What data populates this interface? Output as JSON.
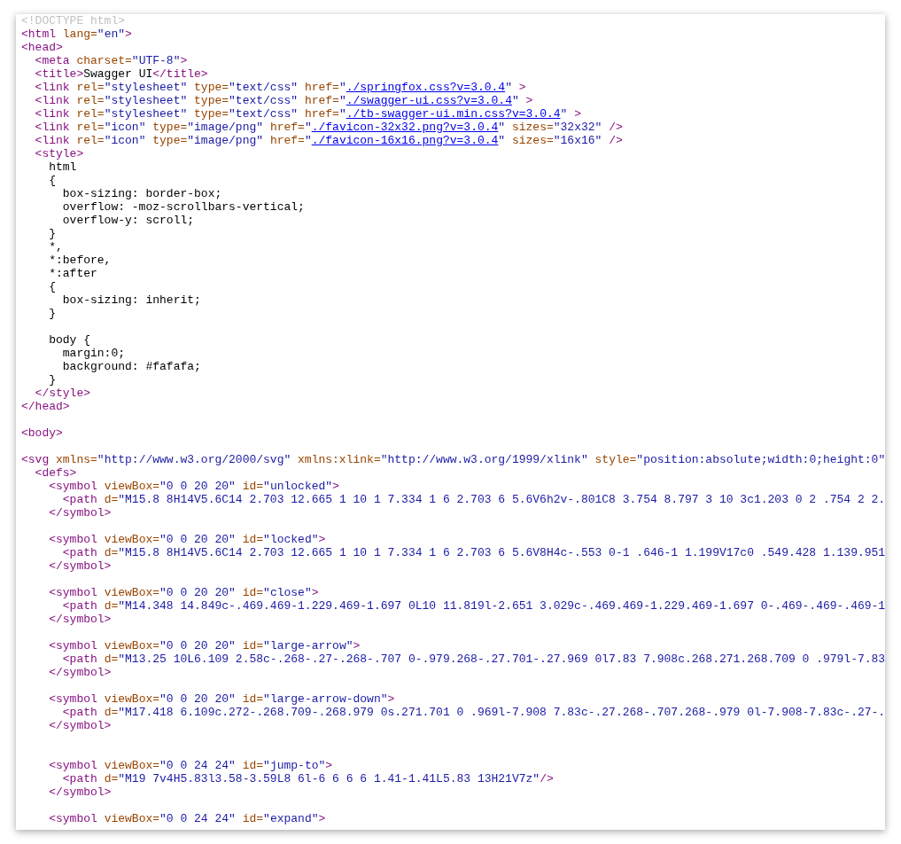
{
  "source_lines": [
    {
      "kind": "code",
      "tokens": [
        {
          "kind": "doctype",
          "text": "<!DOCTYPE html>"
        }
      ]
    },
    {
      "kind": "code",
      "tokens": [
        {
          "kind": "tag",
          "text": "<html"
        },
        {
          "kind": "attr",
          "text": " lang="
        },
        {
          "kind": "value",
          "text": "\"en\""
        },
        {
          "kind": "tag",
          "text": ">"
        }
      ]
    },
    {
      "kind": "code",
      "tokens": [
        {
          "kind": "tag",
          "text": "<head>"
        }
      ]
    },
    {
      "kind": "code",
      "tokens": [
        {
          "kind": "tag",
          "text": "  <meta"
        },
        {
          "kind": "attr",
          "text": " charset="
        },
        {
          "kind": "value",
          "text": "\"UTF-8\""
        },
        {
          "kind": "tag",
          "text": ">"
        }
      ]
    },
    {
      "kind": "code",
      "tokens": [
        {
          "kind": "tag",
          "text": "  <title>"
        },
        {
          "kind": "text",
          "text": "Swagger UI"
        },
        {
          "kind": "tag",
          "text": "</title>"
        }
      ]
    },
    {
      "kind": "code",
      "tokens": [
        {
          "kind": "tag",
          "text": "  <link"
        },
        {
          "kind": "attr",
          "text": " rel="
        },
        {
          "kind": "value",
          "text": "\"stylesheet\""
        },
        {
          "kind": "attr",
          "text": " type="
        },
        {
          "kind": "value",
          "text": "\"text/css\""
        },
        {
          "kind": "attr",
          "text": " href="
        },
        {
          "kind": "value",
          "text": "\""
        },
        {
          "kind": "link",
          "text": "./springfox.css?v=3.0.4"
        },
        {
          "kind": "value",
          "text": "\""
        },
        {
          "kind": "tag",
          "text": " >"
        }
      ]
    },
    {
      "kind": "code",
      "tokens": [
        {
          "kind": "tag",
          "text": "  <link"
        },
        {
          "kind": "attr",
          "text": " rel="
        },
        {
          "kind": "value",
          "text": "\"stylesheet\""
        },
        {
          "kind": "attr",
          "text": " type="
        },
        {
          "kind": "value",
          "text": "\"text/css\""
        },
        {
          "kind": "attr",
          "text": " href="
        },
        {
          "kind": "value",
          "text": "\""
        },
        {
          "kind": "link",
          "text": "./swagger-ui.css?v=3.0.4"
        },
        {
          "kind": "value",
          "text": "\""
        },
        {
          "kind": "tag",
          "text": " >"
        }
      ]
    },
    {
      "kind": "code",
      "tokens": [
        {
          "kind": "tag",
          "text": "  <link"
        },
        {
          "kind": "attr",
          "text": " rel="
        },
        {
          "kind": "value",
          "text": "\"stylesheet\""
        },
        {
          "kind": "attr",
          "text": " type="
        },
        {
          "kind": "value",
          "text": "\"text/css\""
        },
        {
          "kind": "attr",
          "text": " href="
        },
        {
          "kind": "value",
          "text": "\""
        },
        {
          "kind": "link",
          "text": "./tb-swagger-ui.min.css?v=3.0.4"
        },
        {
          "kind": "value",
          "text": "\""
        },
        {
          "kind": "tag",
          "text": " >"
        }
      ]
    },
    {
      "kind": "code",
      "tokens": [
        {
          "kind": "tag",
          "text": "  <link"
        },
        {
          "kind": "attr",
          "text": " rel="
        },
        {
          "kind": "value",
          "text": "\"icon\""
        },
        {
          "kind": "attr",
          "text": " type="
        },
        {
          "kind": "value",
          "text": "\"image/png\""
        },
        {
          "kind": "attr",
          "text": " href="
        },
        {
          "kind": "value",
          "text": "\""
        },
        {
          "kind": "link",
          "text": "./favicon-32x32.png?v=3.0.4"
        },
        {
          "kind": "value",
          "text": "\""
        },
        {
          "kind": "attr",
          "text": " sizes="
        },
        {
          "kind": "value",
          "text": "\"32x32\""
        },
        {
          "kind": "tag",
          "text": " />"
        }
      ]
    },
    {
      "kind": "code",
      "tokens": [
        {
          "kind": "tag",
          "text": "  <link"
        },
        {
          "kind": "attr",
          "text": " rel="
        },
        {
          "kind": "value",
          "text": "\"icon\""
        },
        {
          "kind": "attr",
          "text": " type="
        },
        {
          "kind": "value",
          "text": "\"image/png\""
        },
        {
          "kind": "attr",
          "text": " href="
        },
        {
          "kind": "value",
          "text": "\""
        },
        {
          "kind": "link",
          "text": "./favicon-16x16.png?v=3.0.4"
        },
        {
          "kind": "value",
          "text": "\""
        },
        {
          "kind": "attr",
          "text": " sizes="
        },
        {
          "kind": "value",
          "text": "\"16x16\""
        },
        {
          "kind": "tag",
          "text": " />"
        }
      ]
    },
    {
      "kind": "code",
      "tokens": [
        {
          "kind": "tag",
          "text": "  <style>"
        }
      ]
    },
    {
      "kind": "code",
      "tokens": [
        {
          "kind": "text",
          "text": "    html"
        }
      ]
    },
    {
      "kind": "code",
      "tokens": [
        {
          "kind": "text",
          "text": "    {"
        }
      ]
    },
    {
      "kind": "code",
      "tokens": [
        {
          "kind": "text",
          "text": "      box-sizing: border-box;"
        }
      ]
    },
    {
      "kind": "code",
      "tokens": [
        {
          "kind": "text",
          "text": "      overflow: -moz-scrollbars-vertical;"
        }
      ]
    },
    {
      "kind": "code",
      "tokens": [
        {
          "kind": "text",
          "text": "      overflow-y: scroll;"
        }
      ]
    },
    {
      "kind": "code",
      "tokens": [
        {
          "kind": "text",
          "text": "    }"
        }
      ]
    },
    {
      "kind": "code",
      "tokens": [
        {
          "kind": "text",
          "text": "    *,"
        }
      ]
    },
    {
      "kind": "code",
      "tokens": [
        {
          "kind": "text",
          "text": "    *:before,"
        }
      ]
    },
    {
      "kind": "code",
      "tokens": [
        {
          "kind": "text",
          "text": "    *:after"
        }
      ]
    },
    {
      "kind": "code",
      "tokens": [
        {
          "kind": "text",
          "text": "    {"
        }
      ]
    },
    {
      "kind": "code",
      "tokens": [
        {
          "kind": "text",
          "text": "      box-sizing: inherit;"
        }
      ]
    },
    {
      "kind": "code",
      "tokens": [
        {
          "kind": "text",
          "text": "    }"
        }
      ]
    },
    {
      "kind": "blank"
    },
    {
      "kind": "code",
      "tokens": [
        {
          "kind": "text",
          "text": "    body {"
        }
      ]
    },
    {
      "kind": "code",
      "tokens": [
        {
          "kind": "text",
          "text": "      margin:0;"
        }
      ]
    },
    {
      "kind": "code",
      "tokens": [
        {
          "kind": "text",
          "text": "      background: #fafafa;"
        }
      ]
    },
    {
      "kind": "code",
      "tokens": [
        {
          "kind": "text",
          "text": "    }"
        }
      ]
    },
    {
      "kind": "code",
      "tokens": [
        {
          "kind": "tag",
          "text": "  </style>"
        }
      ]
    },
    {
      "kind": "code",
      "tokens": [
        {
          "kind": "tag",
          "text": "</head>"
        }
      ]
    },
    {
      "kind": "blank"
    },
    {
      "kind": "code",
      "tokens": [
        {
          "kind": "tag",
          "text": "<body>"
        }
      ]
    },
    {
      "kind": "blank"
    },
    {
      "kind": "code",
      "tokens": [
        {
          "kind": "tag",
          "text": "<svg"
        },
        {
          "kind": "attr",
          "text": " xmlns="
        },
        {
          "kind": "value",
          "text": "\"http://www.w3.org/2000/svg\""
        },
        {
          "kind": "attr",
          "text": " xmlns:xlink="
        },
        {
          "kind": "value",
          "text": "\"http://www.w3.org/1999/xlink\""
        },
        {
          "kind": "attr",
          "text": " style="
        },
        {
          "kind": "value",
          "text": "\"position:absolute;width:0;height:0\""
        }
      ]
    },
    {
      "kind": "code",
      "tokens": [
        {
          "kind": "tag",
          "text": "  <defs>"
        }
      ]
    },
    {
      "kind": "code",
      "tokens": [
        {
          "kind": "tag",
          "text": "    <symbol"
        },
        {
          "kind": "attr",
          "text": " viewBox="
        },
        {
          "kind": "value",
          "text": "\"0 0 20 20\""
        },
        {
          "kind": "attr",
          "text": " id="
        },
        {
          "kind": "value",
          "text": "\"unlocked\""
        },
        {
          "kind": "tag",
          "text": ">"
        }
      ]
    },
    {
      "kind": "code",
      "tokens": [
        {
          "kind": "tag",
          "text": "      <path"
        },
        {
          "kind": "attr",
          "text": " d="
        },
        {
          "kind": "value",
          "text": "\"M15.8 8H14V5.6C14 2.703 12.665 1 10 1 7.334 1 6 2.703 6 5.6V6h2v-.801C8 3.754 8.797 3 10 3c1.203 0 2 .754 2 2."
        }
      ]
    },
    {
      "kind": "code",
      "tokens": [
        {
          "kind": "tag",
          "text": "    </symbol>"
        }
      ]
    },
    {
      "kind": "blank"
    },
    {
      "kind": "code",
      "tokens": [
        {
          "kind": "tag",
          "text": "    <symbol"
        },
        {
          "kind": "attr",
          "text": " viewBox="
        },
        {
          "kind": "value",
          "text": "\"0 0 20 20\""
        },
        {
          "kind": "attr",
          "text": " id="
        },
        {
          "kind": "value",
          "text": "\"locked\""
        },
        {
          "kind": "tag",
          "text": ">"
        }
      ]
    },
    {
      "kind": "code",
      "tokens": [
        {
          "kind": "tag",
          "text": "      <path"
        },
        {
          "kind": "attr",
          "text": " d="
        },
        {
          "kind": "value",
          "text": "\"M15.8 8H14V5.6C14 2.703 12.665 1 10 1 7.334 1 6 2.703 6 5.6V8H4c-.553 0-1 .646-1 1.199V17c0 .549.428 1.139.951"
        }
      ]
    },
    {
      "kind": "code",
      "tokens": [
        {
          "kind": "tag",
          "text": "    </symbol>"
        }
      ]
    },
    {
      "kind": "blank"
    },
    {
      "kind": "code",
      "tokens": [
        {
          "kind": "tag",
          "text": "    <symbol"
        },
        {
          "kind": "attr",
          "text": " viewBox="
        },
        {
          "kind": "value",
          "text": "\"0 0 20 20\""
        },
        {
          "kind": "attr",
          "text": " id="
        },
        {
          "kind": "value",
          "text": "\"close\""
        },
        {
          "kind": "tag",
          "text": ">"
        }
      ]
    },
    {
      "kind": "code",
      "tokens": [
        {
          "kind": "tag",
          "text": "      <path"
        },
        {
          "kind": "attr",
          "text": " d="
        },
        {
          "kind": "value",
          "text": "\"M14.348 14.849c-.469.469-1.229.469-1.697 0L10 11.819l-2.651 3.029c-.469.469-1.229.469-1.697 0-.469-.469-.469-1"
        }
      ]
    },
    {
      "kind": "code",
      "tokens": [
        {
          "kind": "tag",
          "text": "    </symbol>"
        }
      ]
    },
    {
      "kind": "blank"
    },
    {
      "kind": "code",
      "tokens": [
        {
          "kind": "tag",
          "text": "    <symbol"
        },
        {
          "kind": "attr",
          "text": " viewBox="
        },
        {
          "kind": "value",
          "text": "\"0 0 20 20\""
        },
        {
          "kind": "attr",
          "text": " id="
        },
        {
          "kind": "value",
          "text": "\"large-arrow\""
        },
        {
          "kind": "tag",
          "text": ">"
        }
      ]
    },
    {
      "kind": "code",
      "tokens": [
        {
          "kind": "tag",
          "text": "      <path"
        },
        {
          "kind": "attr",
          "text": " d="
        },
        {
          "kind": "value",
          "text": "\"M13.25 10L6.109 2.58c-.268-.27-.268-.707 0-.979.268-.27.701-.27.969 0l7.83 7.908c.268.271.268.709 0 .979l-7.83"
        }
      ]
    },
    {
      "kind": "code",
      "tokens": [
        {
          "kind": "tag",
          "text": "    </symbol>"
        }
      ]
    },
    {
      "kind": "blank"
    },
    {
      "kind": "code",
      "tokens": [
        {
          "kind": "tag",
          "text": "    <symbol"
        },
        {
          "kind": "attr",
          "text": " viewBox="
        },
        {
          "kind": "value",
          "text": "\"0 0 20 20\""
        },
        {
          "kind": "attr",
          "text": " id="
        },
        {
          "kind": "value",
          "text": "\"large-arrow-down\""
        },
        {
          "kind": "tag",
          "text": ">"
        }
      ]
    },
    {
      "kind": "code",
      "tokens": [
        {
          "kind": "tag",
          "text": "      <path"
        },
        {
          "kind": "attr",
          "text": " d="
        },
        {
          "kind": "value",
          "text": "\"M17.418 6.109c.272-.268.709-.268.979 0s.271.701 0 .969l-7.908 7.83c-.27.268-.707.268-.979 0l-7.908-7.83c-.27-."
        }
      ]
    },
    {
      "kind": "code",
      "tokens": [
        {
          "kind": "tag",
          "text": "    </symbol>"
        }
      ]
    },
    {
      "kind": "blank"
    },
    {
      "kind": "blank"
    },
    {
      "kind": "code",
      "tokens": [
        {
          "kind": "tag",
          "text": "    <symbol"
        },
        {
          "kind": "attr",
          "text": " viewBox="
        },
        {
          "kind": "value",
          "text": "\"0 0 24 24\""
        },
        {
          "kind": "attr",
          "text": " id="
        },
        {
          "kind": "value",
          "text": "\"jump-to\""
        },
        {
          "kind": "tag",
          "text": ">"
        }
      ]
    },
    {
      "kind": "code",
      "tokens": [
        {
          "kind": "tag",
          "text": "      <path"
        },
        {
          "kind": "attr",
          "text": " d="
        },
        {
          "kind": "value",
          "text": "\"M19 7v4H5.83l3.58-3.59L8 6l-6 6 6 6 1.41-1.41L5.83 13H21V7z\""
        },
        {
          "kind": "tag",
          "text": "/>"
        }
      ]
    },
    {
      "kind": "code",
      "tokens": [
        {
          "kind": "tag",
          "text": "    </symbol>"
        }
      ]
    },
    {
      "kind": "blank"
    },
    {
      "kind": "code",
      "tokens": [
        {
          "kind": "tag",
          "text": "    <symbol"
        },
        {
          "kind": "attr",
          "text": " viewBox="
        },
        {
          "kind": "value",
          "text": "\"0 0 24 24\""
        },
        {
          "kind": "attr",
          "text": " id="
        },
        {
          "kind": "value",
          "text": "\"expand\""
        },
        {
          "kind": "tag",
          "text": ">"
        }
      ]
    }
  ]
}
